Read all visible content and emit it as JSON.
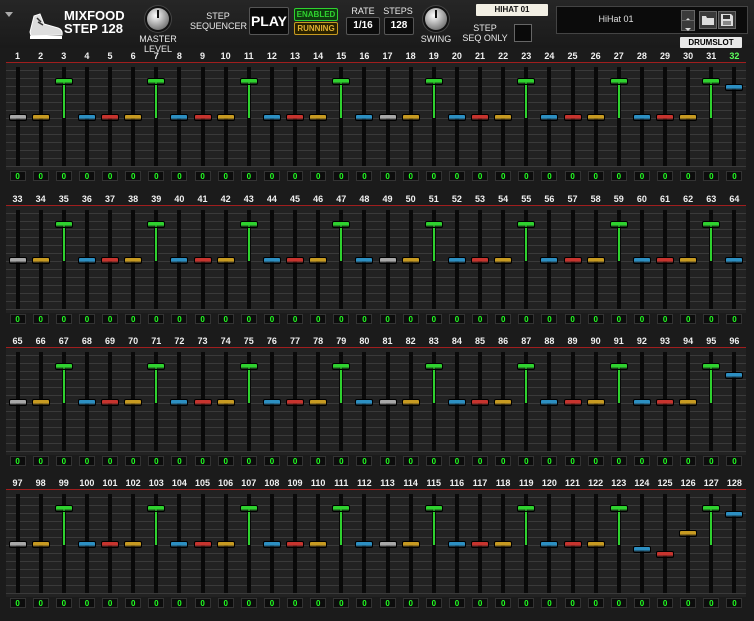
{
  "header": {
    "logo_line1": "MIXFOOD",
    "logo_line2": "STEP 128",
    "master_level_label": "MASTER LEVEL",
    "step_sequencer_label_1": "STEP",
    "step_sequencer_label_2": "SEQUENCER",
    "play_label": "PLAY",
    "enabled_label": "ENABLED",
    "running_label": "RUNNING",
    "rate_label": "RATE",
    "rate_value": "1/16",
    "steps_label": "STEPS",
    "steps_value": "128",
    "swing_label": "SWING",
    "instrument_tag": "HIHAT 01",
    "step_seq_only_label_1": "STEP",
    "step_seq_only_label_2": "SEQ ONLY",
    "preset_name": "HiHat 01",
    "drumslot_label": "DRUMSLOT"
  },
  "colors": {
    "accent_green": "#2fd22f",
    "highlight_step_number": "#5dff5d",
    "lane_top_line": "#a01e1e",
    "cap_gray": "#a8a8a8",
    "cap_red": "#c7342e",
    "cap_yellow": "#c79a21",
    "cap_blue": "#2c8fc2"
  },
  "icons": {
    "menu": "menu-arrow-icon",
    "logo": "sneaker-icon",
    "up": "chevron-up-icon",
    "down": "chevron-down-icon",
    "folder": "folder-icon",
    "save": "save-icon"
  },
  "steps": {
    "count": 128,
    "highlighted_step": 32,
    "values_displayed": "0",
    "accent_steps": [
      3,
      7,
      11,
      15,
      19,
      23,
      27,
      31,
      35,
      39,
      43,
      47,
      51,
      55,
      59,
      63,
      67,
      71,
      75,
      79,
      83,
      87,
      91,
      95,
      99,
      103,
      107,
      111,
      115,
      119,
      123,
      127
    ],
    "raised_blue_steps": {
      "32": 0.78,
      "64": 0.5,
      "96": 0.75,
      "128": 0.78
    },
    "low_steps": {
      "124": 0.45,
      "125": 0.4,
      "126": 0.6
    },
    "cap_cycle": [
      "gray",
      "yellow",
      "gray",
      "blue",
      "red",
      "yellow",
      "gray",
      "blue",
      "red",
      "yellow",
      "gray",
      "blue",
      "red",
      "yellow",
      "gray",
      "blue"
    ]
  }
}
